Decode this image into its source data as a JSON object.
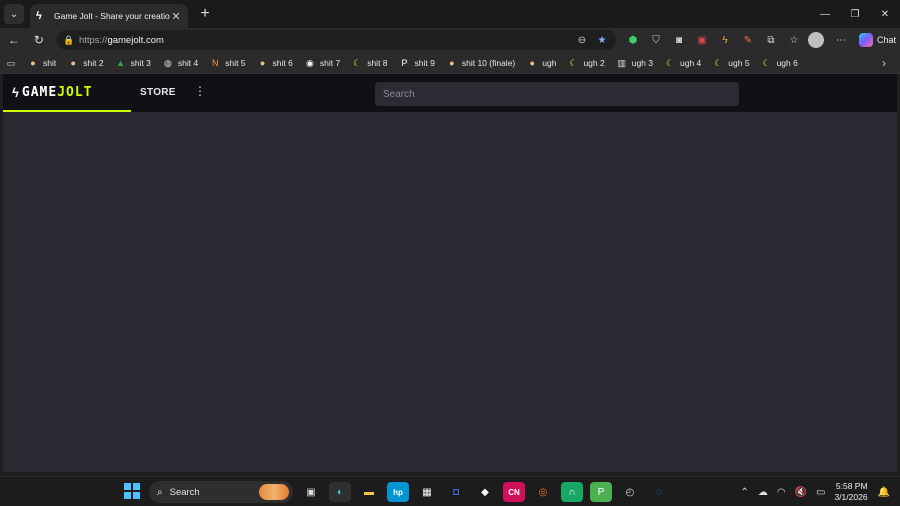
{
  "browser": {
    "tab": {
      "title": "Game Jolt - Share your creations",
      "favicon": "bolt-icon",
      "close": "✕"
    },
    "new_tab": "+",
    "window_controls": {
      "minimize": "—",
      "restore": "❐",
      "close": "✕"
    },
    "address": {
      "scheme": "https://",
      "host": "gamejolt.com"
    },
    "copilot_label": "Chat"
  },
  "favorites": [
    {
      "label": "shit",
      "icon": "egg-icon",
      "glyph": "●",
      "color": "#e8c48a"
    },
    {
      "label": "shit 2",
      "icon": "egg-icon",
      "glyph": "●",
      "color": "#e8c48a"
    },
    {
      "label": "shit 3",
      "icon": "drive-icon",
      "glyph": "▲",
      "color": "#34a853"
    },
    {
      "label": "shit 4",
      "icon": "globe-icon",
      "glyph": "◍",
      "color": "#dddddd"
    },
    {
      "label": "shit 5",
      "icon": "ng-icon",
      "glyph": "N",
      "color": "#f2994a"
    },
    {
      "label": "shit 6",
      "icon": "egg-icon",
      "glyph": "●",
      "color": "#e8c48a"
    },
    {
      "label": "shit 7",
      "icon": "github-icon",
      "glyph": "◉",
      "color": "#ffffff"
    },
    {
      "label": "shit 8",
      "icon": "banana-icon",
      "glyph": "☾",
      "color": "#f7d34a"
    },
    {
      "label": "shit 9",
      "icon": "p-icon",
      "glyph": "P",
      "color": "#ffffff"
    },
    {
      "label": "shit 10 (finale)",
      "icon": "egg-icon",
      "glyph": "●",
      "color": "#e8c48a"
    },
    {
      "label": "ugh",
      "icon": "egg-icon",
      "glyph": "●",
      "color": "#e8c48a"
    },
    {
      "label": "ugh 2",
      "icon": "banana-icon",
      "glyph": "☾",
      "color": "#f7d34a"
    },
    {
      "label": "ugh 3",
      "icon": "bin-icon",
      "glyph": "▥",
      "color": "#dddddd"
    },
    {
      "label": "ugh 4",
      "icon": "banana-icon",
      "glyph": "☾",
      "color": "#f7d34a"
    },
    {
      "label": "ugh 5",
      "icon": "banana-icon",
      "glyph": "☾",
      "color": "#f7d34a"
    },
    {
      "label": "ugh 6",
      "icon": "banana-icon",
      "glyph": "☾",
      "color": "#f7d34a"
    }
  ],
  "gamejolt": {
    "logo_text_a": "GAME",
    "logo_text_b": "JOLT",
    "store_label": "STORE",
    "search_placeholder": "Search",
    "accent": "#ccff00"
  },
  "taskbar": {
    "search_label": "Search",
    "time": "5:58 PM",
    "date": "3/1/2026",
    "apps": [
      {
        "name": "task-view-icon",
        "glyph": "▣",
        "color": "#dddddd",
        "bg": "transparent"
      },
      {
        "name": "edge-icon",
        "glyph": "◐",
        "color": "#3ccfcf",
        "bg": "#2f2f2f"
      },
      {
        "name": "file-explorer-icon",
        "glyph": "▬",
        "color": "#f5c542",
        "bg": "transparent"
      },
      {
        "name": "hp-icon",
        "glyph": "hp",
        "color": "#ffffff",
        "bg": "#0096d6"
      },
      {
        "name": "store-icon",
        "glyph": "▦",
        "color": "#ffffff",
        "bg": "transparent"
      },
      {
        "name": "app-blue-icon",
        "glyph": "◘",
        "color": "#3d7bff",
        "bg": "transparent"
      },
      {
        "name": "roblox-icon",
        "glyph": "◆",
        "color": "#ffffff",
        "bg": "transparent"
      },
      {
        "name": "cn-icon",
        "glyph": "CN",
        "color": "#ffffff",
        "bg": "#d1105a"
      },
      {
        "name": "blender-icon",
        "glyph": "◎",
        "color": "#f5792a",
        "bg": "transparent"
      },
      {
        "name": "green-app-icon",
        "glyph": "∩",
        "color": "#ffffff",
        "bg": "#17a864"
      },
      {
        "name": "p-app-icon",
        "glyph": "P",
        "color": "#ffffff",
        "bg": "#4caf50"
      },
      {
        "name": "steam-icon",
        "glyph": "◴",
        "color": "#dddddd",
        "bg": "transparent"
      },
      {
        "name": "circle-app-icon",
        "glyph": "◌",
        "color": "#2f8fd8",
        "bg": "transparent"
      }
    ]
  }
}
